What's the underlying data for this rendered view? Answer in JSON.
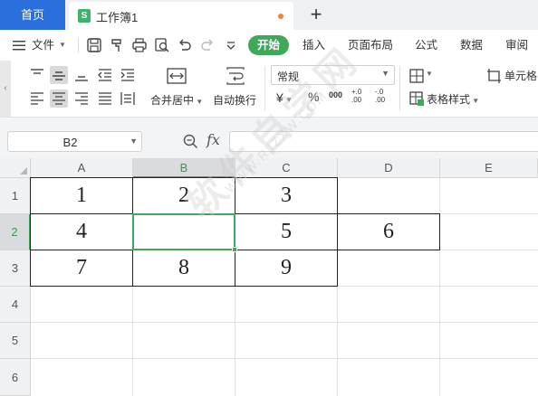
{
  "tabs": {
    "home_label": "首页",
    "doc_icon_letter": "S",
    "doc_title": "工作簿1",
    "new_tab_symbol": "+"
  },
  "menubar": {
    "file_label": "文件",
    "tabs": [
      "开始",
      "插入",
      "页面布局",
      "公式",
      "数据",
      "审阅"
    ],
    "active_tab": "开始"
  },
  "ribbon": {
    "merge_center_label": "合并居中",
    "wrap_text_label": "自动换行",
    "number_format": "常规",
    "currency_symbol": "¥",
    "percent_symbol": "%",
    "thousands_symbol": "000",
    "inc_decimal_symbol": "+.0 .00",
    "dec_decimal_symbol": "-.0 .00",
    "cell_format_label": "单元格",
    "table_style_label": "表格样式"
  },
  "formula_bar": {
    "name_box": "B2",
    "fx_label": "fx",
    "formula_value": ""
  },
  "grid": {
    "columns": [
      "A",
      "B",
      "C",
      "D",
      "E"
    ],
    "rows": [
      "1",
      "2",
      "3",
      "4",
      "5",
      "6"
    ],
    "active_cell": "B2",
    "cells": {
      "A1": "1",
      "B1": "2",
      "C1": "3",
      "A2": "4",
      "B2": "",
      "C2": "5",
      "D2": "6",
      "A3": "7",
      "B3": "8",
      "C3": "9"
    }
  },
  "watermark": {
    "text": "软件自学网",
    "url": "WWW.RJZXW.COM"
  },
  "colors": {
    "accent_green": "#3fa85a",
    "home_tab_blue": "#2b6fdc",
    "doc_icon_green": "#3fb26e",
    "unsaved_dot": "#f0833a"
  }
}
